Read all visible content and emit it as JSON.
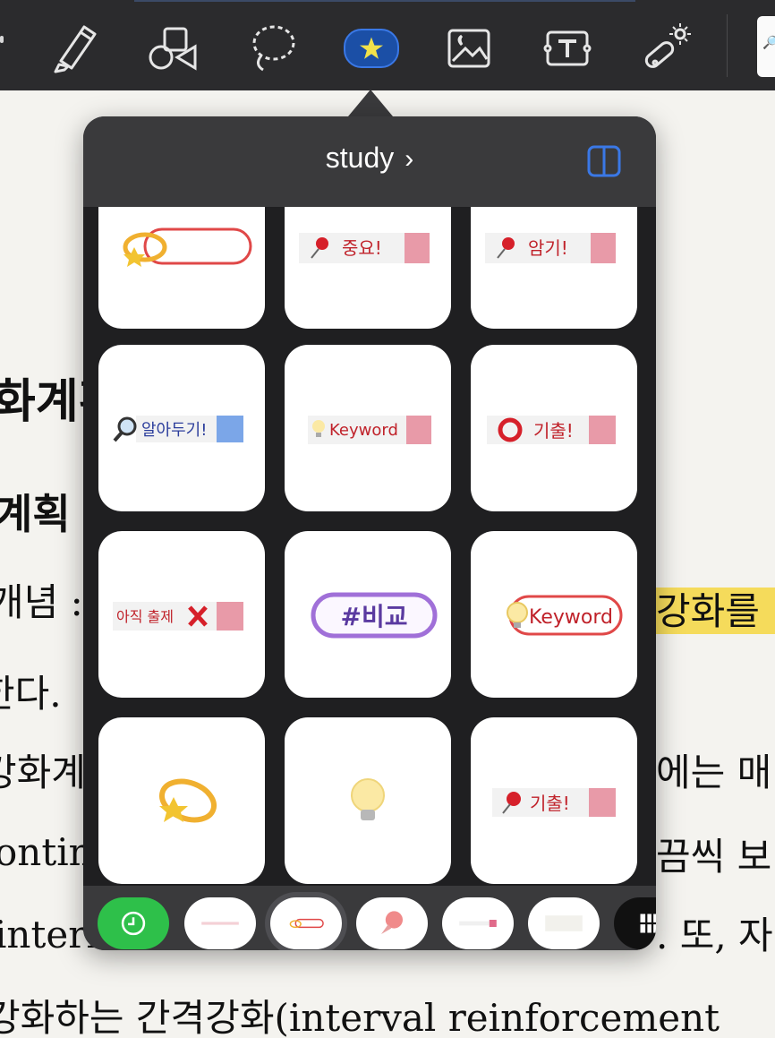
{
  "popover": {
    "title": "study",
    "title_chevron": "›"
  },
  "toolbar": {
    "tools": [
      "highlighter-icon",
      "shapes-icon",
      "lasso-icon",
      "sticker-icon",
      "image-icon",
      "textbox-icon",
      "laser-pointer-icon"
    ],
    "active_tool": "sticker-icon",
    "search_glyph": "🔎"
  },
  "stickers": [
    {
      "kind": "comet-oval"
    },
    {
      "kind": "pin-label",
      "text": "중요!"
    },
    {
      "kind": "pin-label",
      "text": "암기!"
    },
    {
      "kind": "magnifier-label",
      "text": "알아두기!"
    },
    {
      "kind": "bulb-label",
      "text": "Keyword"
    },
    {
      "kind": "circle-label",
      "text": "기출!"
    },
    {
      "kind": "x-label",
      "text": "아직 출제"
    },
    {
      "kind": "hash-oval",
      "text": "#비교"
    },
    {
      "kind": "bulb-oval",
      "text": "Keyword"
    },
    {
      "kind": "comet"
    },
    {
      "kind": "bulb"
    },
    {
      "kind": "pin-label",
      "text": "기출!"
    }
  ],
  "tabs": [
    "recent-icon",
    "ribbon-tab",
    "oval-tab",
    "pushpin-tab",
    "tape-tab",
    "note-tab",
    "grid-tab"
  ],
  "selected_tab": "oval-tab",
  "document": {
    "lines": [
      {
        "text": "화계획"
      },
      {
        "text": "계획"
      },
      {
        "text": "개념 :"
      },
      {
        "text": "강화를"
      },
      {
        "text": "한다."
      },
      {
        "text": "강화계"
      },
      {
        "text": "에는 매"
      },
      {
        "text": "ontin"
      },
      {
        "text": "끔씩 보"
      },
      {
        "text": "intern"
      },
      {
        "text": ". 또, 자"
      },
      {
        "text": "강화하는 간격강화(interval reinforcement"
      }
    ]
  },
  "colors": {
    "accent": "#3a78e6",
    "recent_green": "#2ec04a",
    "sticker_pink": "#e89aa8",
    "sticker_red": "#d6202a",
    "hash_purple": "#a070d8"
  }
}
